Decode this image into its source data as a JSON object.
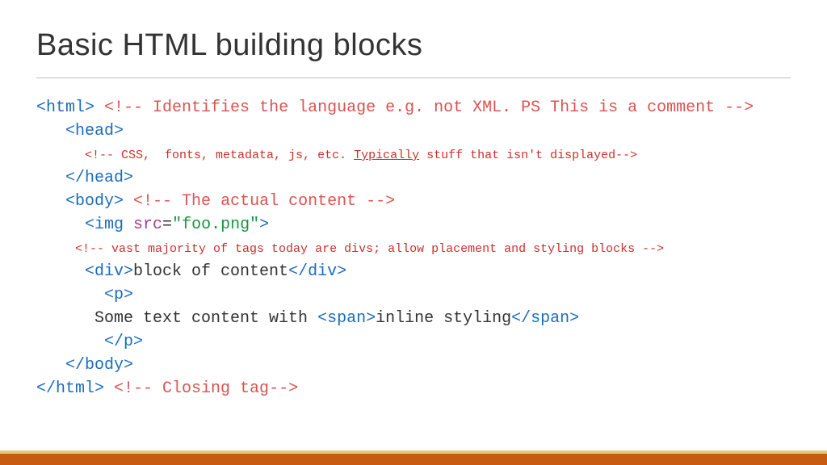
{
  "title": "Basic HTML building blocks",
  "code": {
    "l1_tag": "<html>",
    "l1_comment": "<!-- Identifies the language e.g. not XML. PS This is a comment -->",
    "l2_tag": "<head>",
    "l3_pre": "<!-- CSS,  fonts, metadata, js, etc. ",
    "l3_u": "Typically",
    "l3_post": " stuff that isn't displayed-->",
    "l4_tag": "</head>",
    "l5_tag": "<body>",
    "l5_comment": "<!-- The actual content -->",
    "l6_open": "<img ",
    "l6_attr": "src",
    "l6_eq": "=",
    "l6_val": "\"foo.png\"",
    "l6_close": ">",
    "l7_comment": "<!-- vast majority of tags today are divs; allow placement and styling blocks -->",
    "l8_open": "<div>",
    "l8_text": "block of content",
    "l8_close": "</div>",
    "l9_tag": "<p>",
    "l10_text1": "Some text content with ",
    "l10_span_open": "<span>",
    "l10_text2": "inline styling",
    "l10_span_close": "</span>",
    "l11_tag": "</p>",
    "l12_tag": "</body>",
    "l13_tag": "</html>",
    "l13_comment": "<!-- Closing tag-->"
  }
}
